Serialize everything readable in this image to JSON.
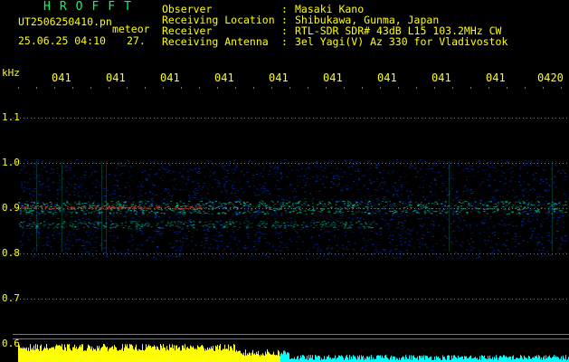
{
  "header": {
    "app_title": "HROFFT",
    "filename": "UT2506250410.pn",
    "mode": "meteor",
    "datetime": "25.06.25 04:10",
    "counter": "27."
  },
  "info": [
    {
      "label": "Observer",
      "value": "Masaki Kano"
    },
    {
      "label": "Receiving Location",
      "value": "Shibukawa, Gunma, Japan"
    },
    {
      "label": "Receiver",
      "value": "RTL-SDR SDR# 43dB L15 103.2MHz CW"
    },
    {
      "label": "Receiving Antenna",
      "value": "3el Yagi(V) Az 330 for Vladivostok"
    }
  ],
  "separator": ":",
  "spectrogram": {
    "unit": "kHz",
    "time_ticks": [
      "041",
      "041",
      "041",
      "041",
      "041",
      "041",
      "041",
      "041",
      "041",
      "0420"
    ],
    "freq_ticks": [
      "1.1",
      "1.0",
      "0.9",
      "0.8",
      "0.7",
      "0.6"
    ],
    "colors": {
      "background": "#000000",
      "noise": "#0033cc",
      "signal": "#00cc99",
      "strong": "#ff3300",
      "level_bar": "#ffff00",
      "level_bar_end": "#00ffff",
      "grid": "#777777",
      "text": "#ffff00"
    }
  }
}
